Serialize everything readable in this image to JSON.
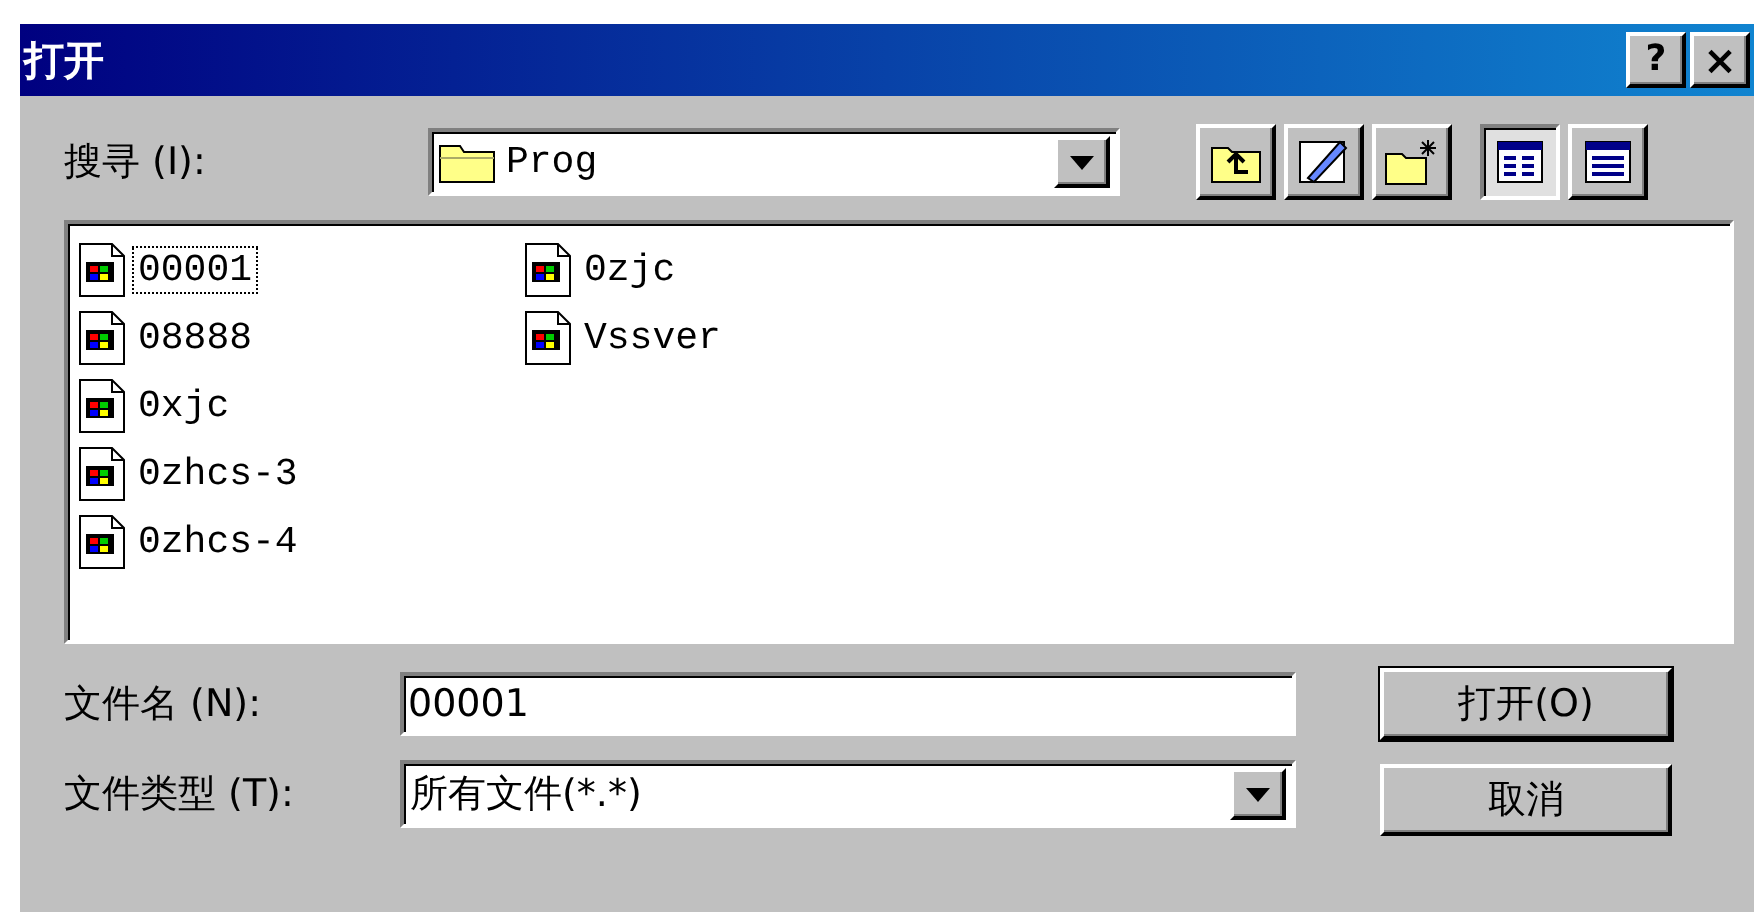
{
  "window": {
    "title": "打开"
  },
  "title_buttons": [
    {
      "kind": "help",
      "label": "?"
    },
    {
      "kind": "close",
      "label": "×"
    }
  ],
  "look_in": {
    "label": "搜寻 (I):",
    "value": "Prog"
  },
  "toolbar": [
    {
      "kind": "up",
      "selected": false
    },
    {
      "kind": "desktop",
      "selected": false
    },
    {
      "kind": "new-folder",
      "selected": false
    },
    {
      "kind": "list",
      "selected": true
    },
    {
      "kind": "details",
      "selected": false
    }
  ],
  "files": [
    {
      "name": "00001",
      "selected": true
    },
    {
      "name": "08888",
      "selected": false
    },
    {
      "name": "0xjc",
      "selected": false
    },
    {
      "name": "0zhcs-3",
      "selected": false
    },
    {
      "name": "0zhcs-4",
      "selected": false
    },
    {
      "name": "0zjc",
      "selected": false
    },
    {
      "name": "Vssver",
      "selected": false
    }
  ],
  "file_name": {
    "label": "文件名 (N):",
    "value": "00001"
  },
  "file_type": {
    "label": "文件类型 (T):",
    "value": "所有文件(*.*)"
  },
  "buttons": [
    "打开(O)",
    "取消"
  ]
}
